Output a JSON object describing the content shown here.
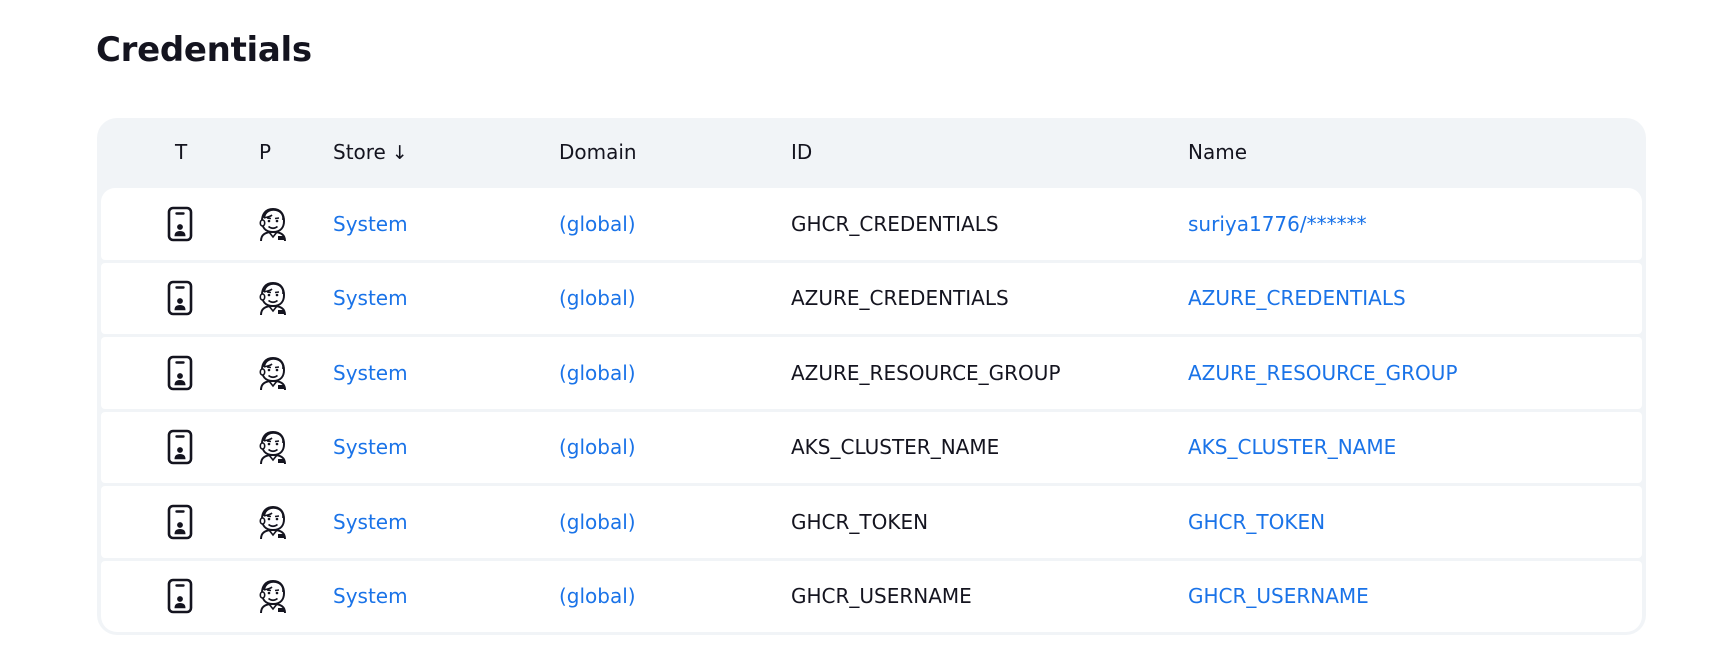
{
  "page": {
    "title": "Credentials"
  },
  "table": {
    "headers": {
      "type": "T",
      "provider": "P",
      "store": "Store",
      "store_sort": "↓",
      "domain": "Domain",
      "id": "ID",
      "name": "Name"
    },
    "rows": [
      {
        "type_icon": "credential-card-icon",
        "provider_icon": "jenkins-icon",
        "store": "System",
        "domain": "(global)",
        "id": "GHCR_CREDENTIALS",
        "name": "suriya1776/******"
      },
      {
        "type_icon": "credential-card-icon",
        "provider_icon": "jenkins-icon",
        "store": "System",
        "domain": "(global)",
        "id": "AZURE_CREDENTIALS",
        "name": "AZURE_CREDENTIALS"
      },
      {
        "type_icon": "credential-card-icon",
        "provider_icon": "jenkins-icon",
        "store": "System",
        "domain": "(global)",
        "id": "AZURE_RESOURCE_GROUP",
        "name": "AZURE_RESOURCE_GROUP"
      },
      {
        "type_icon": "credential-card-icon",
        "provider_icon": "jenkins-icon",
        "store": "System",
        "domain": "(global)",
        "id": "AKS_CLUSTER_NAME",
        "name": "AKS_CLUSTER_NAME"
      },
      {
        "type_icon": "credential-card-icon",
        "provider_icon": "jenkins-icon",
        "store": "System",
        "domain": "(global)",
        "id": "GHCR_TOKEN",
        "name": "GHCR_TOKEN"
      },
      {
        "type_icon": "credential-card-icon",
        "provider_icon": "jenkins-icon",
        "store": "System",
        "domain": "(global)",
        "id": "GHCR_USERNAME",
        "name": "GHCR_USERNAME"
      }
    ]
  },
  "colors": {
    "link": "#1a73e8",
    "text": "#14141f",
    "table_background": "#f1f4f7",
    "row_background": "#ffffff"
  }
}
